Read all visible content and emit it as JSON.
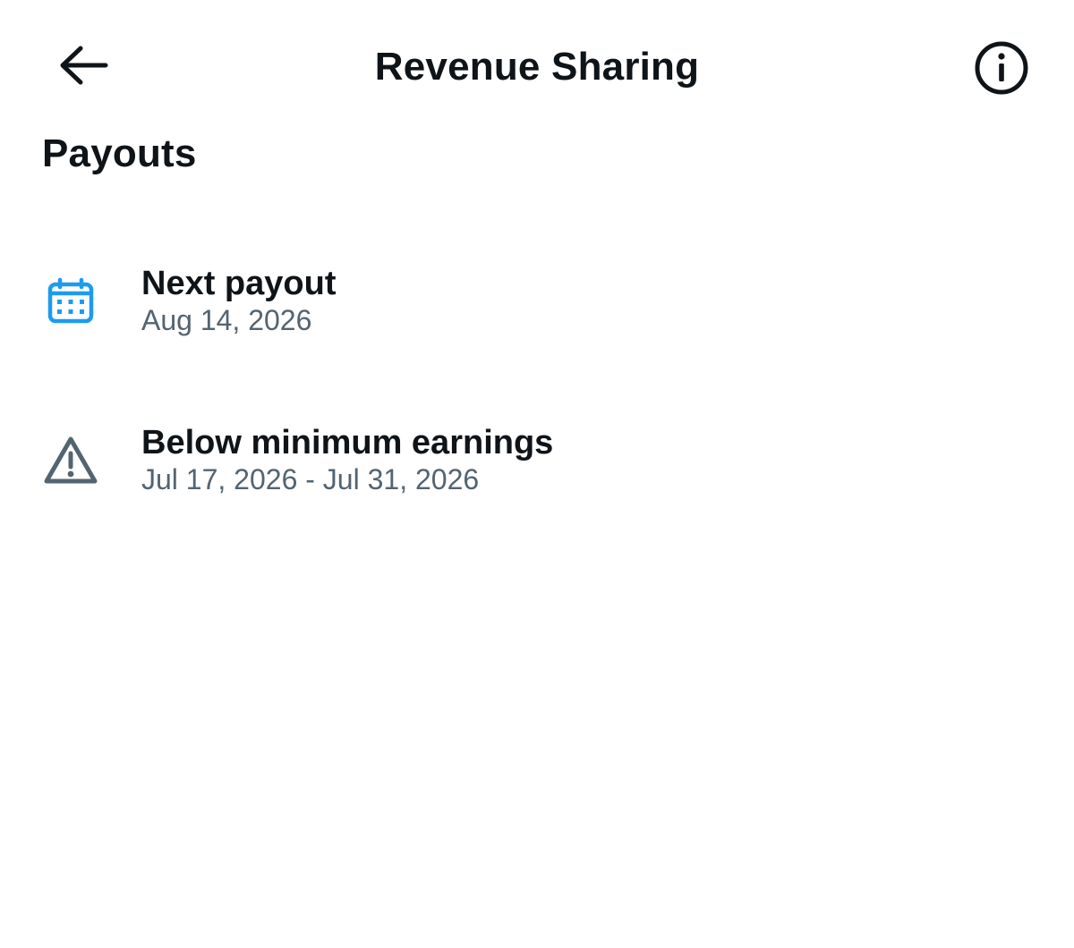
{
  "header": {
    "title": "Revenue Sharing",
    "back_icon": "arrow-left-icon",
    "info_icon": "info-circle-icon"
  },
  "section": {
    "title": "Payouts"
  },
  "items": [
    {
      "icon": "calendar-icon",
      "icon_color": "#1d9bf0",
      "title": "Next payout",
      "subtitle": "Aug 14, 2026"
    },
    {
      "icon": "warning-triangle-icon",
      "icon_color": "#536471",
      "title": "Below minimum earnings",
      "subtitle": "Jul 17, 2026 - Jul 31, 2026"
    }
  ],
  "colors": {
    "text_primary": "#0f1419",
    "text_secondary": "#536471",
    "background": "#ffffff"
  }
}
